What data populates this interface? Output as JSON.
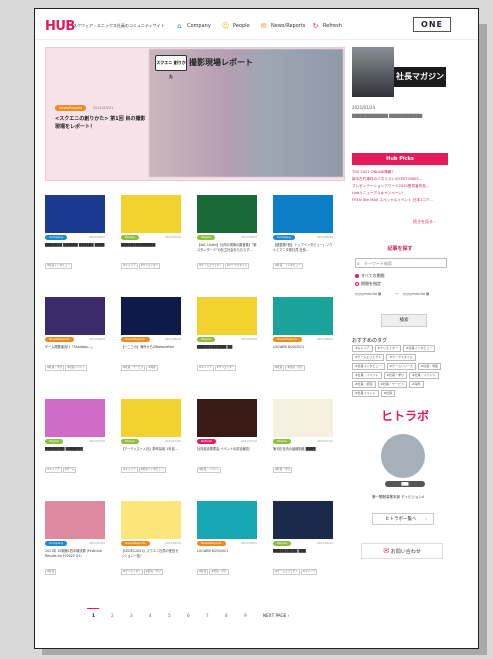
{
  "header": {
    "logo": "HUB",
    "logo_sub": "スクウェア・エニックス社員のコミュニティサイト",
    "nav": [
      {
        "label": "Company",
        "icon": "building-icon",
        "color": "#1b8ad6"
      },
      {
        "label": "People",
        "icon": "people-icon",
        "color": "#e0b400"
      },
      {
        "label": "News/Reports",
        "icon": "news-icon",
        "color": "#f08a1d"
      },
      {
        "label": "Refresh",
        "icon": "refresh-icon",
        "color": "#e6195a"
      }
    ],
    "one_button": "ONE"
  },
  "hero": {
    "badge": "スクエニ 創りかた",
    "title": "撮影現場レポート",
    "tag": "News/Reports",
    "date": "2021/03/21",
    "text": "<スクエニの創りかた> 第1回 目の撮影現場をレポート！"
  },
  "sidebar": {
    "magazine": "社長マガジン",
    "date": "2021/01/24",
    "text_blur": "█████████████ ████████████",
    "picks_title": "Hub Picks",
    "picks": [
      "TGS 2021 ONLINE情報！",
      "新中古竹事件のパネリストのTESTORIES…",
      "プレゼンテーションアワード2020受賞者作品…",
      "Hubリニューアルキャンペーン！",
      "FFXIV 8th MAX スペシャルイベント 日本1コア…"
    ],
    "picks_more": "続きを見る ›",
    "search_title": "記事を探す",
    "keyword_placeholder": "キーワード検索",
    "radio_all": "すべての期間",
    "radio_period": "期間を指定",
    "date_placeholder": "yyyy/mm/dd",
    "date_sep": "〜",
    "search_button": "検索",
    "rec_title": "おすすめのタグ",
    "rec_tags": [
      "#キャリア",
      "#クリエイター",
      "#社員インタビュー",
      "#ゲームエフェクト",
      "#ワークスタイル",
      "#社員インタビュー",
      "#ゲームリリース",
      "#社員・特集",
      "#社員・イベント",
      "#社員・学び",
      "#社員・イベント",
      "#社員・調査",
      "#社員・サービス",
      "#海外",
      "#社員イベント",
      "#社員"
    ],
    "hitora_logo": "ヒトラボ",
    "hito_name": "███",
    "hito_sub": "第一開発事業本部 ディビジョン4",
    "hito_button": "ヒトラボ一覧へ",
    "contact": "お問い合わせ"
  },
  "cards": [
    {
      "tag": "Company",
      "tagcolor": "#1b8ad6",
      "date": "2021/09/05",
      "title": "███████ ██████ ██████ ████",
      "tags": [
        "#社員インタビュー"
      ],
      "thumb": "#1b3a8f"
    },
    {
      "tag": "People",
      "tagcolor": "#8bbf3c",
      "date": "2021/09/10",
      "title": "██████████████",
      "tags": [
        "#キャリア",
        "#クリエイター"
      ],
      "thumb": "#f3d230"
    },
    {
      "tag": "People",
      "tagcolor": "#8bbf3c",
      "date": "2021/09/05",
      "title": "【VoC Listen】社内の現場の雑音集】\"新スタンダード\"の社立社会をもたらす…",
      "tags": [
        "#ゲームエフェクト",
        "#ワークスタイル"
      ],
      "thumb": "#1a6a38"
    },
    {
      "tag": "Company",
      "tagcolor": "#1b8ad6",
      "date": "2021/08/26",
      "title": "【連載第7回】トップインタビュー」ソウルとアニタ新社員 社長…",
      "tags": [
        "#社員・インタビュー"
      ],
      "thumb": "#0d7fc8"
    },
    {
      "tag": "News/Reports",
      "tagcolor": "#f08a1d",
      "date": "2021/08/20",
      "title": "ゲーム開発者向け「Shadows…」",
      "tags": [
        "#社員・学び",
        "#社員イベント"
      ],
      "thumb": "#3d2a6b"
    },
    {
      "tag": "News/Reports",
      "tagcolor": "#f08a1d",
      "date": "2021/08/18",
      "title": "【一二三の】海外からのNewsLetter",
      "tags": [
        "#社員・サービス",
        "#海外"
      ],
      "thumb": "#0e1a4a"
    },
    {
      "tag": "People",
      "tagcolor": "#8bbf3c",
      "date": "2021/08/10",
      "title": "████████████ ██",
      "tags": [
        "#キャリア",
        "#クリエイター"
      ],
      "thumb": "#f3d230"
    },
    {
      "tag": "News/Reports",
      "tagcolor": "#f08a1d",
      "date": "2021/08/05",
      "title": "LOCWEB 8/20/2021",
      "tags": [
        "#社員",
        "#社員・学び"
      ],
      "thumb": "#19a39a"
    },
    {
      "tag": "People",
      "tagcolor": "#8bbf3c",
      "date": "2021/07/30",
      "title": "████████ ███████",
      "tags": [
        "#キャリア",
        "#ゲーム"
      ],
      "thumb": "#d06bc8"
    },
    {
      "tag": "People",
      "tagcolor": "#8bbf3c",
      "date": "2021/07/26",
      "title": "【アーティスト入社】新卒採用 1年目…",
      "tags": [
        "#キャリア",
        "#社員インタビュー"
      ],
      "thumb": "#f3d230"
    },
    {
      "tag": "Refresh",
      "tagcolor": "#e6195a",
      "date": "2021/07/20",
      "title": "社内部活発表会 イベントの試合報告！",
      "tags": [
        "#社員・イベント"
      ],
      "thumb": "#3a1a14"
    },
    {
      "tag": "People",
      "tagcolor": "#8bbf3c",
      "date": "2021/07/10",
      "title": "第1回 社内の組織制度 ████",
      "tags": [
        "#社員・学び"
      ],
      "thumb": "#f5f0e0"
    },
    {
      "tag": "Company",
      "tagcolor": "#1b8ad6",
      "date": "2021/07/05",
      "title": "2021年 10期第1四半期決算 (Financial Results for FY2022 Q1)",
      "tags": [
        "#社員"
      ],
      "thumb": "#e08aa0"
    },
    {
      "tag": "News/Reports",
      "tagcolor": "#f08a1d",
      "date": "2021/06/30",
      "title": "【CEDEC2021】スクエニ社員の受賞セッション一覧！",
      "tags": [
        "#クリエイター",
        "#社員・学び"
      ],
      "thumb": "#fbe67a"
    },
    {
      "tag": "News/Reports",
      "tagcolor": "#f08a1d",
      "date": "2021/06/25",
      "title": "LOCWEB 6/25/2021",
      "tags": [
        "#社員",
        "#社員・学び"
      ],
      "thumb": "#16a6b4"
    },
    {
      "tag": "People",
      "tagcolor": "#8bbf3c",
      "date": "2021/06/15",
      "title": "██████████ ███",
      "tags": [
        "#ゲームエフェクト",
        "#キャリア"
      ],
      "thumb": "#1b2a4a"
    }
  ],
  "pagination": [
    "1",
    "2",
    "3",
    "4",
    "5",
    "6",
    "7",
    "8",
    "9"
  ],
  "next_label": "NEXT PAGE ›"
}
